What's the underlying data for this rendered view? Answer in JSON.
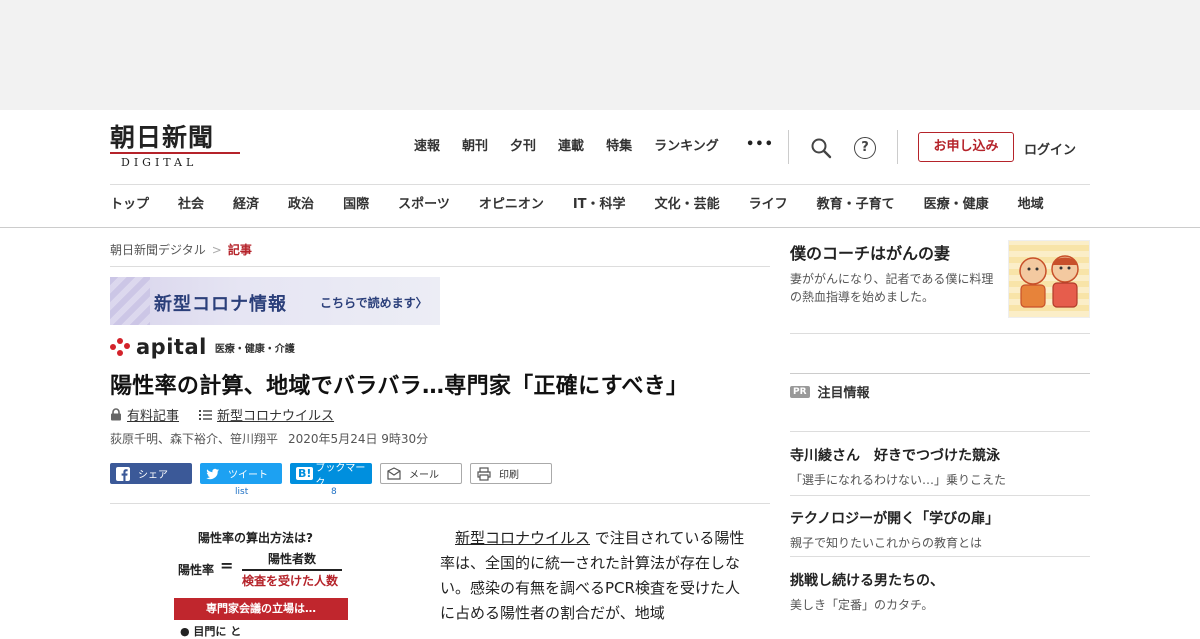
{
  "logo": {
    "main": "朝日新聞",
    "sub": "DIGITAL"
  },
  "topnav": [
    "速報",
    "朝刊",
    "夕刊",
    "連載",
    "特集",
    "ランキング"
  ],
  "more": "•••",
  "help": "?",
  "subscribe": "お申し込み",
  "login": "ログイン",
  "categories": [
    "トップ",
    "社会",
    "経済",
    "政治",
    "国際",
    "スポーツ",
    "オピニオン",
    "IT・科学",
    "文化・芸能",
    "ライフ",
    "教育・子育て",
    "医療・健康",
    "地域"
  ],
  "breadcrumb": {
    "home": "朝日新聞デジタル",
    "sep": ">",
    "current": "記事"
  },
  "banner": {
    "title": "新型コロナ情報",
    "link": "こちらで読めます〉"
  },
  "apital": {
    "logo": "apital",
    "sub": "医療・健康・介護"
  },
  "article": {
    "headline": "陽性率の計算、地域でバラバラ…専門家「正確にすべき」",
    "tag_paid": "有料記事",
    "tag_topic": "新型コロナウイルス",
    "authors": "荻原千明、森下裕介、笹川翔平",
    "date": "2020年5月24日 9時30分",
    "body_link": "新型コロナウイルス",
    "body_rest": "で注目されている陽性率は、全国的に統一された計算法が存在しない。感染の有無を調べるPCR検査を受けた人に占める陽性者の割合だが、地域"
  },
  "share": {
    "facebook": "シェア",
    "twitter": "ツイート",
    "hatena": "ブックマーク",
    "hatena_icon": "B!",
    "mail": "メール",
    "print": "印刷",
    "twitter_count": "list",
    "hatena_count": "8"
  },
  "figure": {
    "title": "陽性率の算出方法は?",
    "label": "陽性率",
    "eq": "=",
    "numerator": "陽性者数",
    "denominator": "検査を受けた人数",
    "box": "専門家会議の立場は…",
    "foot": "●  目門に と"
  },
  "sidebar": {
    "feature": {
      "title": "僕のコーチはがんの妻",
      "desc": "妻ががんになり、記者である僕に料理の熱血指導を始めました。"
    },
    "pr_badge": "PR",
    "pr_title": "注目情報",
    "items": [
      {
        "title": "寺川綾さん　好きでつづけた競泳",
        "desc": "「選手になれるわけない…」乗りこえた"
      },
      {
        "title": "テクノロジーが開く「学びの扉」",
        "desc": "親子で知りたいこれからの教育とは"
      },
      {
        "title": "挑戦し続ける男たちの、",
        "desc": "美しき「定番」のカタチ。"
      }
    ]
  },
  "colors": {
    "accent": "#b5232a",
    "facebook": "#3b5998",
    "twitter": "#1da1f2",
    "hatena": "#008fde",
    "apital": "#d3222a"
  }
}
